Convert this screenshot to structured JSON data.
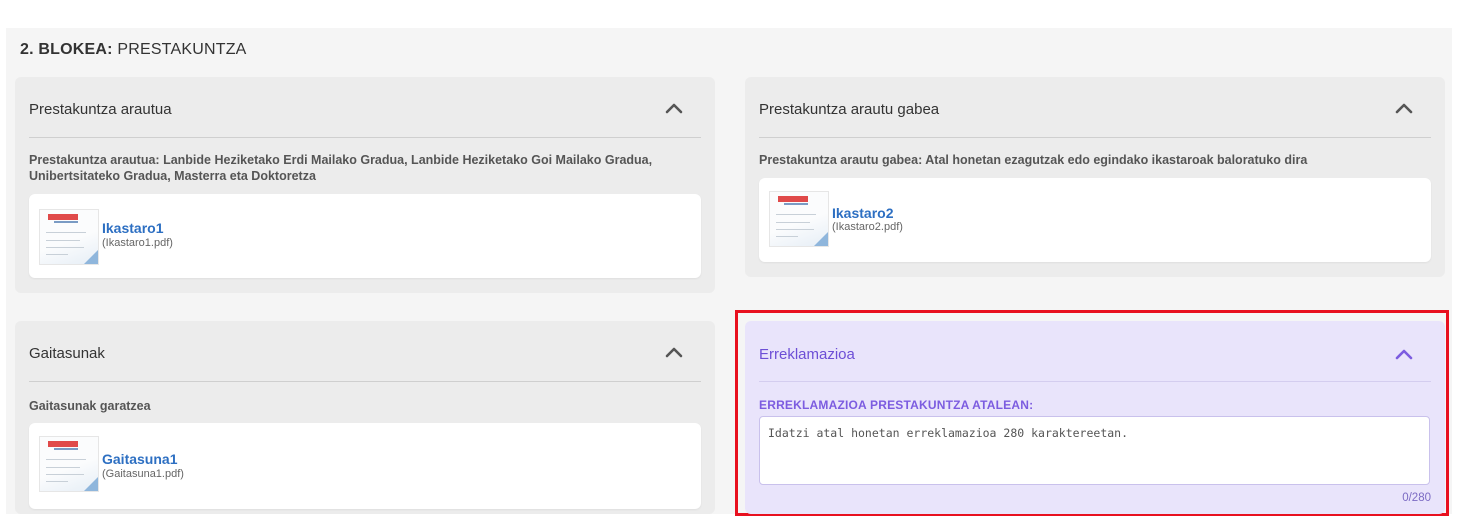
{
  "block": {
    "title_bold": "2. BLOKEA:",
    "title_rest": " PRESTAKUNTZA"
  },
  "cards": {
    "regulated": {
      "title": "Prestakuntza arautua",
      "description": "Prestakuntza arautua: Lanbide Heziketako Erdi Mailako Gradua, Lanbide Heziketako Goi Mailako Gradua, Unibertsitateko Gradua, Masterra eta Doktoretza",
      "file": {
        "name": "Ikastaro1",
        "filename": "(Ikastaro1.pdf)"
      }
    },
    "unregulated": {
      "title": "Prestakuntza arautu gabea",
      "description": "Prestakuntza arautu gabea: Atal honetan ezagutzak edo egindako ikastaroak baloratuko dira",
      "file": {
        "name": "Ikastaro2",
        "filename": "(Ikastaro2.pdf)"
      }
    },
    "skills": {
      "title": "Gaitasunak",
      "description": "Gaitasunak garatzea",
      "file": {
        "name": "Gaitasuna1",
        "filename": "(Gaitasuna1.pdf)"
      }
    },
    "claim": {
      "title": "Erreklamazioa",
      "label": "ERREKLAMAZIOA PRESTAKUNTZA ATALEAN:",
      "placeholder": "Idatzi atal honetan erreklamazioa 280 karaktereetan.",
      "value": "",
      "counter": "0/280"
    }
  },
  "colors": {
    "link": "#2d6fc2",
    "claim_accent": "#6d4fd6",
    "claim_bg": "#e9e4fb",
    "highlight": "#e8101f"
  },
  "icons": {
    "collapse": "chevron-up-icon",
    "file_thumbnail": "pdf-thumbnail"
  }
}
